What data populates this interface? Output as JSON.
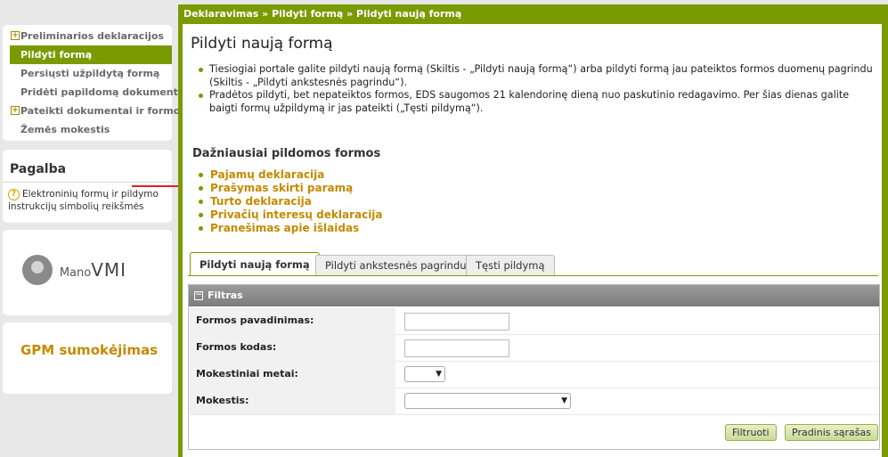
{
  "sidebar": {
    "items": [
      {
        "label": "Preliminarios deklaracijos"
      },
      {
        "label": "Pildyti formą"
      },
      {
        "label": "Persiųsti užpildytą formą"
      },
      {
        "label": "Pridėti papildomą dokumentą"
      },
      {
        "label": "Pateikti dokumentai ir formos"
      },
      {
        "label": "Žemės mokestis"
      }
    ],
    "help_title": "Pagalba",
    "help_link": "Elektroninių formų ir pildymo instrukcijų simbolių reikšmės",
    "mano_prefix": "Mano",
    "mano_name": "VMI",
    "gpm_link": "GPM sumokėjimas"
  },
  "main": {
    "breadcrumb": "Deklaravimas » Pildyti formą » Pildyti naują formą",
    "title": "Pildyti naują formą",
    "bullets": [
      "Tiesiogiai portale galite pildyti naują formą (Skiltis - „Pildyti naują formą“) arba pildyti formą jau pateiktos formos duomenų pagrindu (Skiltis - „Pildyti ankstesnės pagrindu“).",
      "Pradėtos pildyti, bet nepateiktos formos, EDS saugomos 21 kalendorinę dieną nuo paskutinio redagavimo. Per šias dienas galite baigti formų užpildymą ir jas pateikti („Tęsti pildymą“)."
    ],
    "freq_title": "Dažniausiai pildomos formos",
    "freq_forms": [
      "Pajamų deklaracija",
      "Prašymas skirti paramą",
      "Turto deklaracija",
      "Privačių interesų deklaracija",
      "Pranešimas apie išlaidas"
    ],
    "tabs": [
      {
        "label": "Pildyti naują formą"
      },
      {
        "label": "Pildyti ankstesnės pagrindu"
      },
      {
        "label": "Tęsti pildymą"
      }
    ],
    "filter": {
      "title": "Filtras",
      "fields": [
        {
          "label": "Formos pavadinimas:",
          "value": ""
        },
        {
          "label": "Formos kodas:",
          "value": ""
        },
        {
          "label": "Mokestiniai metai:",
          "value": ""
        },
        {
          "label": "Mokestis:",
          "value": ""
        }
      ],
      "filter_button": "Filtruoti",
      "reset_button": "Pradinis sąrašas"
    }
  },
  "colors": {
    "accent": "#7a9a01",
    "link": "#c48a00",
    "arrow": "#e02020"
  },
  "icons": {
    "expand": "plus-square-icon",
    "help": "question-circle-icon",
    "collapse": "minus-square-icon"
  }
}
